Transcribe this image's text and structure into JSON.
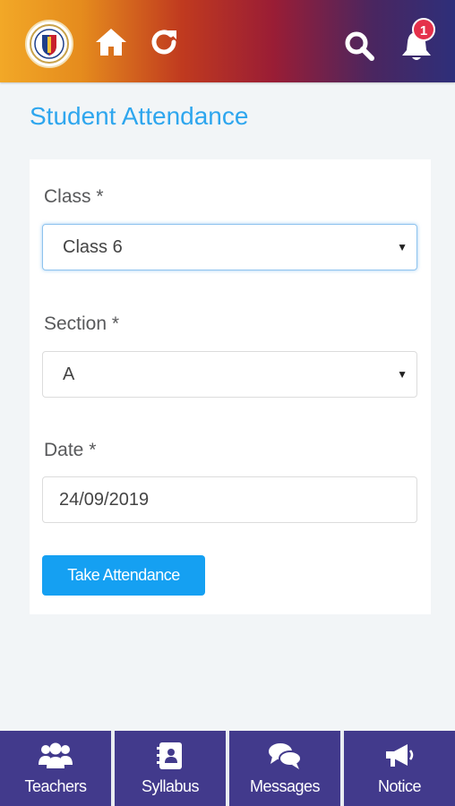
{
  "header": {
    "logo_icon": "school-crest-icon",
    "home_icon": "home-icon",
    "refresh_icon": "refresh-icon",
    "search_icon": "search-icon",
    "notification_icon": "bell-icon",
    "notification_count": "1"
  },
  "page": {
    "title": "Student Attendance"
  },
  "form": {
    "class_label": "Class *",
    "class_value": "Class 6",
    "section_label": "Section *",
    "section_value": "A",
    "date_label": "Date *",
    "date_value": "24/09/2019",
    "submit_label": "Take Attendance"
  },
  "bottom_nav": {
    "items": [
      {
        "label": "Teachers",
        "icon": "users-icon"
      },
      {
        "label": "Syllabus",
        "icon": "contact-book-icon"
      },
      {
        "label": "Messages",
        "icon": "chat-bubbles-icon"
      },
      {
        "label": "Notice",
        "icon": "megaphone-icon"
      }
    ]
  },
  "colors": {
    "accent": "#15a0f2",
    "title": "#2ea6ee",
    "nav_bg": "#423a8c",
    "badge": "#e5314b"
  }
}
